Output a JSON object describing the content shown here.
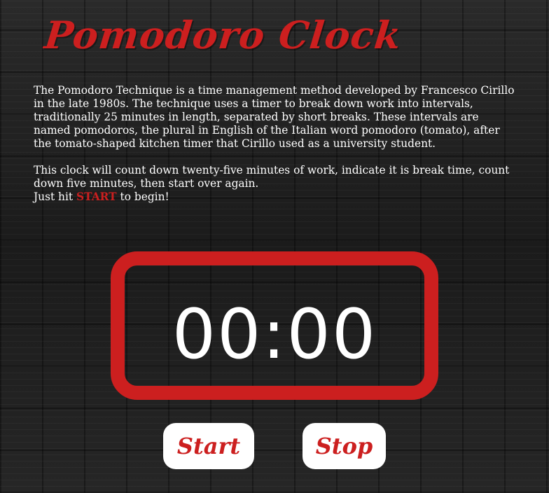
{
  "header": {
    "title": "Pomodoro Clock"
  },
  "intro": {
    "paragraph1": "The Pomodoro Technique is a time management method developed by Francesco Cirillo in the late 1980s. The technique uses a timer to break down work into intervals, traditionally 25 minutes in length, separated by short breaks. These intervals are named pomodoros, the plural in English of the Italian word pomodoro (tomato), after the tomato-shaped kitchen timer that Cirillo used as a university student.",
    "paragraph2": "This clock will count down twenty-five minutes of work, indicate it is break time, count down five minutes, then start over again.",
    "cta_prefix": "Just hit ",
    "cta_keyword": "START",
    "cta_suffix": " to begin!"
  },
  "clock": {
    "display": "00:00"
  },
  "controls": {
    "start_label": "Start",
    "stop_label": "Stop"
  },
  "colors": {
    "accent": "#cc1f1f",
    "text": "#ffffff",
    "background": "#1e1e1e"
  }
}
